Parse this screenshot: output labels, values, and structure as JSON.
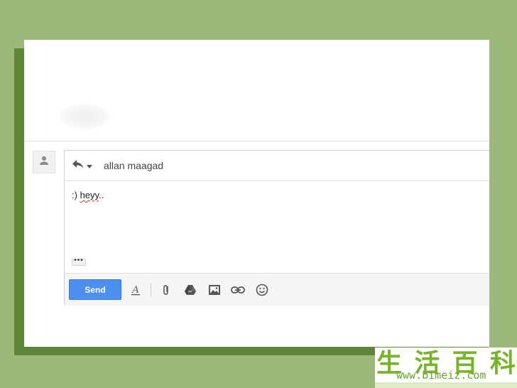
{
  "compose": {
    "recipient": "allan maagad",
    "body_text": ":)",
    "body_misspelled": "heyy",
    "body_suffix": "..",
    "more_label": "•••"
  },
  "toolbar": {
    "send_label": "Send",
    "icons": [
      "format-text-icon",
      "attach-icon",
      "drive-icon",
      "photo-icon",
      "link-icon",
      "emoji-icon"
    ]
  },
  "watermark": {
    "chars": [
      "生",
      "活",
      "百",
      "科"
    ],
    "url": "www.bimeiz.com"
  },
  "colors": {
    "background": "#9cb97b",
    "shadow": "#5f8639",
    "send_button": "#4d8ff0",
    "watermark_green": "#78b428"
  }
}
